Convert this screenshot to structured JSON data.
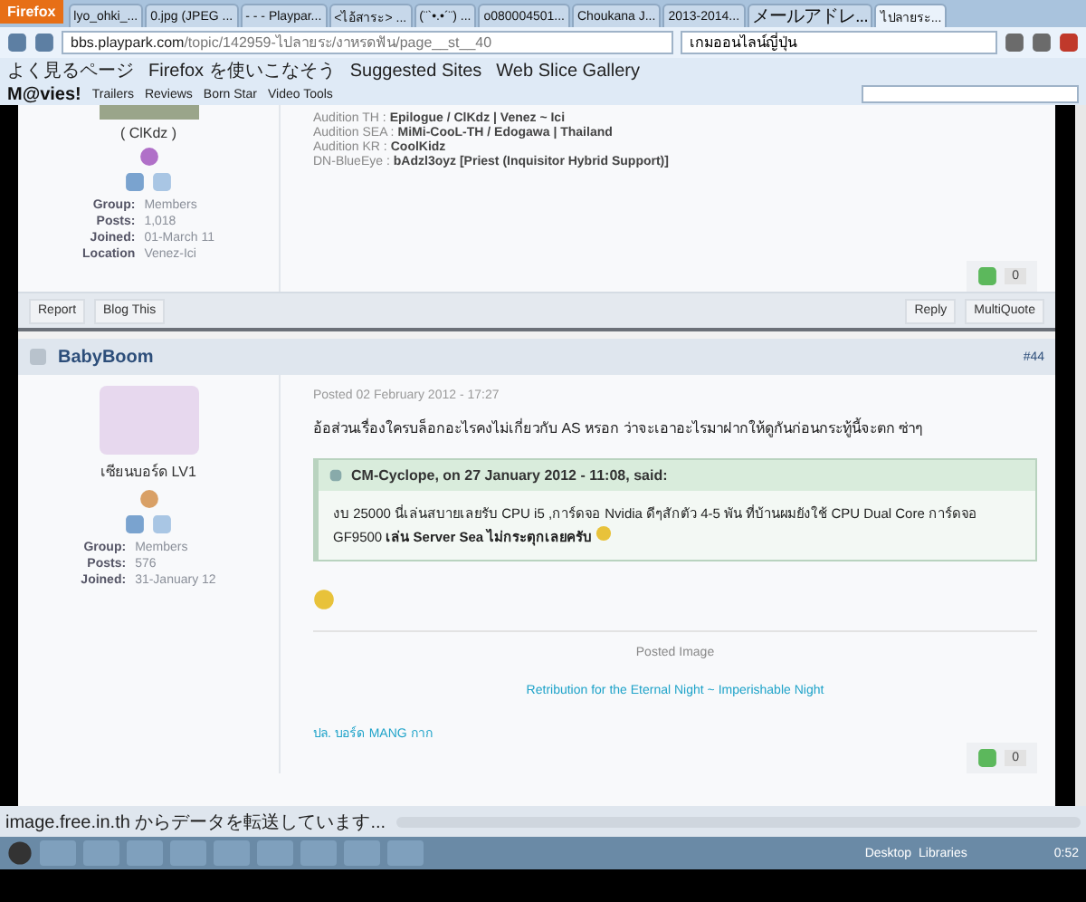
{
  "browser": {
    "menu_button": "Firefox",
    "tabs": [
      {
        "label": "lyo_ohki_...",
        "selected": false
      },
      {
        "label": "0.jpg (JPEG ...",
        "selected": false
      },
      {
        "label": "- - - Playpar...",
        "selected": false
      },
      {
        "label": "<ไอ้สาระ> ...",
        "selected": false
      },
      {
        "label": "(¨`•.•´¨) ...",
        "selected": false
      },
      {
        "label": "o080004501...",
        "selected": false
      },
      {
        "label": "Choukana J...",
        "selected": false
      },
      {
        "label": "2013-2014...",
        "selected": false
      },
      {
        "label": "メールアドレ...",
        "selected": false
      },
      {
        "label": "ไปลายระ...",
        "selected": true
      }
    ],
    "address_host": "bbs.playpark.com",
    "address_path": "/topic/142959-ไปลายระ/งาหรดฟัน/page__st__40",
    "search": "เกมออนไลน์ญี่ปุ่น"
  },
  "bookmarks": [
    "よく見るページ",
    "Firefox を使いこなそう",
    "Suggested Sites",
    "Web Slice Gallery"
  ],
  "toolbar": {
    "logo": "M@vies!",
    "items": [
      "Trailers",
      "Reviews",
      "Born Star",
      "Video Tools"
    ]
  },
  "post_previous": {
    "display_name": "( ClKdz )",
    "info": [
      {
        "label": "Group:",
        "value": "Members"
      },
      {
        "label": "Posts:",
        "value": "1,018"
      },
      {
        "label": "Joined:",
        "value": "01-March 11"
      },
      {
        "label": "Location",
        "value": "Venez-Ici"
      }
    ],
    "signature": [
      {
        "label": "Audition TH :",
        "value": "Epilogue / ClKdz | Venez ~ Ici"
      },
      {
        "label": "Audition SEA :",
        "value": "MiMi-CooL-TH / Edogawa | Thailand"
      },
      {
        "label": "Audition KR :",
        "value": "CoolKidz"
      },
      {
        "label": "DN-BlueEye :",
        "value": "bAdzl3oyz [Priest (Inquisitor Hybrid Support)]"
      }
    ],
    "reputation": "0",
    "left_actions": [
      "Report",
      "Blog This"
    ],
    "right_actions": [
      "Reply",
      "MultiQuote"
    ]
  },
  "post": {
    "author": "BabyBoom",
    "number": "#44",
    "posted": "Posted 02 February 2012 - 17:27",
    "rank": "เซียนบอร์ด LV1",
    "info": [
      {
        "label": "Group:",
        "value": "Members"
      },
      {
        "label": "Posts:",
        "value": "576"
      },
      {
        "label": "Joined:",
        "value": "31-January 12"
      }
    ],
    "text": "อ้อส่วนเรื่องใครบล็อกอะไรคงไม่เกี่ยวกับ AS หรอก ว่าจะเอาอะไรมาฝากให้ดูกันก่อนกระทู้นี้จะตก ซ่าๆ",
    "quote": {
      "citation": "CM-Cyclope, on 27 January 2012 - 11:08, said:",
      "text": "งบ 25000 นี่เล่นสบายเลยรับ CPU i5 ,การ์ดจอ Nvidia ดีๆสักตัว 4-5 พัน ที่บ้านผมยังใช้ CPU Dual Core การ์ดจอ GF9500 **เล่น Server Sea ไม่กระตุกเลยครับ**"
    },
    "image_caption": "Posted Image",
    "link": "Retribution for the Eternal Night ~ Imperishable Night",
    "note": "ปล. บอร์ด MANG กาก",
    "reputation": "0"
  },
  "status": "image.free.in.th からデータを転送しています...",
  "taskbar": {
    "toolbars": [
      "Desktop",
      "Libraries"
    ],
    "time": "0:52"
  }
}
